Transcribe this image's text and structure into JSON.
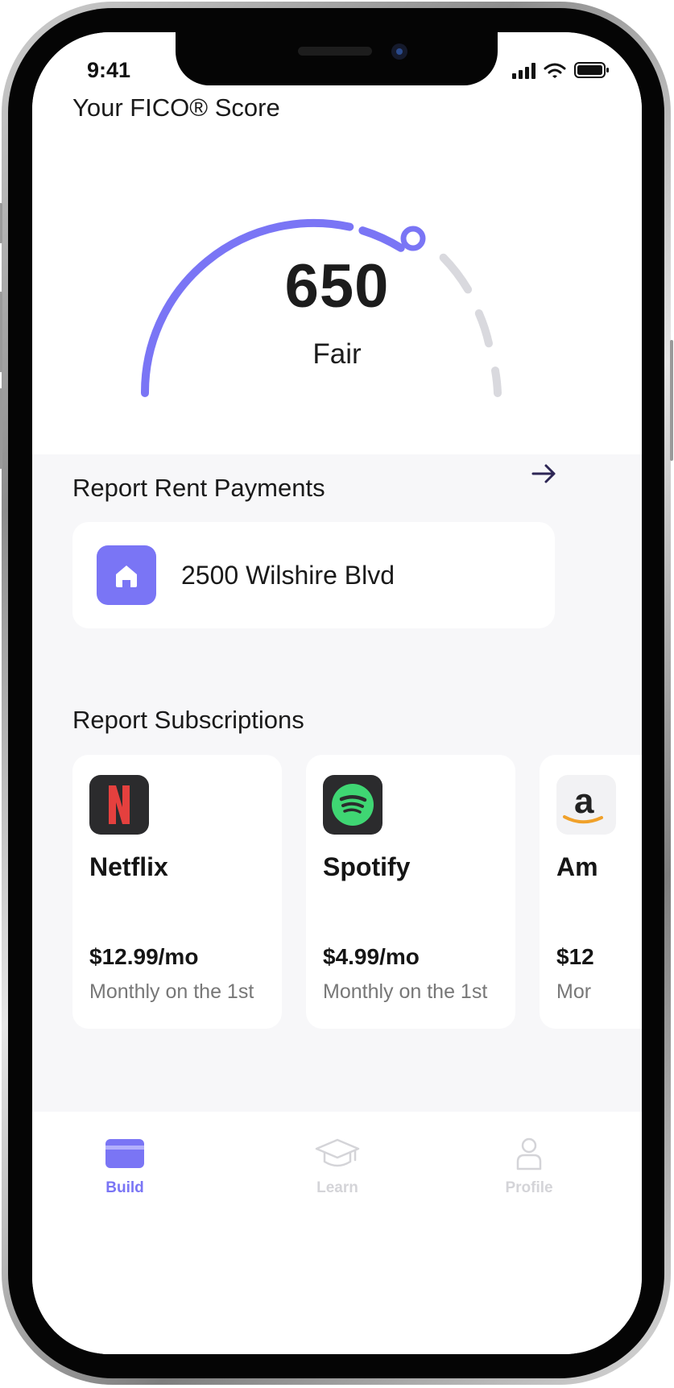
{
  "status_bar": {
    "time": "9:41"
  },
  "score": {
    "title": "Your FICO® Score",
    "value": "650",
    "rating": "Fair"
  },
  "rent": {
    "title": "Report Rent Payments",
    "address": "2500 Wilshire Blvd"
  },
  "subscriptions": {
    "title": "Report Subscriptions",
    "items": [
      {
        "name": "Netflix",
        "price": "$12.99/mo",
        "schedule": "Monthly on the 1st"
      },
      {
        "name": "Spotify",
        "price": "$4.99/mo",
        "schedule": "Monthly on the 1st"
      },
      {
        "name": "Am",
        "price": "$12",
        "schedule": "Mor"
      }
    ]
  },
  "tabs": [
    {
      "label": "Build",
      "icon": "card-icon",
      "active": true
    },
    {
      "label": "Learn",
      "icon": "graduation-cap-icon",
      "active": false
    },
    {
      "label": "Profile",
      "icon": "person-icon",
      "active": false
    }
  ],
  "colors": {
    "accent": "#7a75f5",
    "gauge_track": "#d9d9de",
    "netflix_red": "#e5403e",
    "spotify_green": "#3fd673",
    "tab_inactive": "#d4d4d8"
  }
}
